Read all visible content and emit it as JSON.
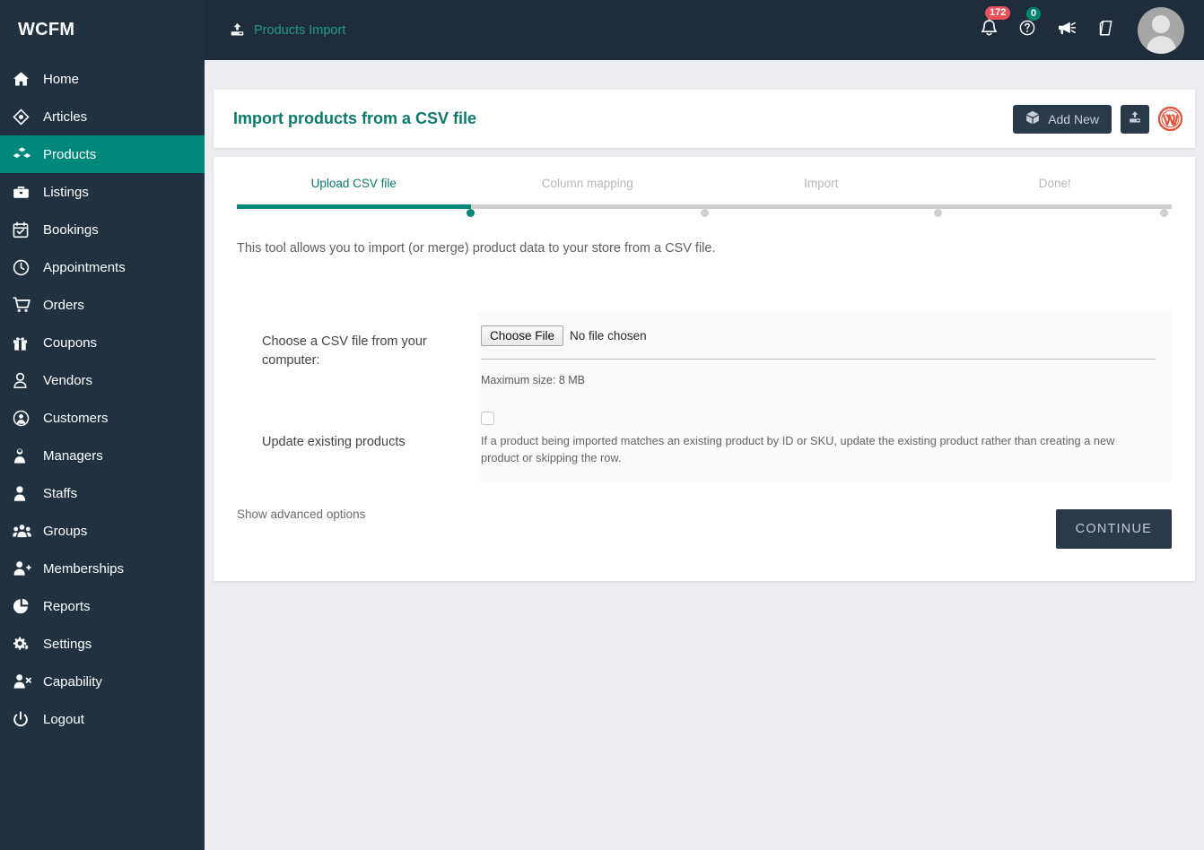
{
  "brand": {
    "name": "WCFM"
  },
  "breadcrumb": {
    "icon": "upload-icon",
    "label": "Products Import"
  },
  "topbar": {
    "notifications": {
      "icon": "bell-icon",
      "badge": "172",
      "badge_color": "#e8505b"
    },
    "help": {
      "icon": "question-circle-icon",
      "badge": "0",
      "badge_color": "#00856f"
    },
    "announcements": {
      "icon": "megaphone-icon"
    },
    "knowledgebase": {
      "icon": "book-icon"
    },
    "profile": {
      "icon": "avatar-icon"
    }
  },
  "sidebar": {
    "items": [
      {
        "icon": "home-icon",
        "label": "Home",
        "active": false
      },
      {
        "icon": "articles-icon",
        "label": "Articles",
        "active": false
      },
      {
        "icon": "products-icon",
        "label": "Products",
        "active": true
      },
      {
        "icon": "briefcase-icon",
        "label": "Listings",
        "active": false
      },
      {
        "icon": "calendar-check-icon",
        "label": "Bookings",
        "active": false
      },
      {
        "icon": "clock-icon",
        "label": "Appointments",
        "active": false
      },
      {
        "icon": "cart-icon",
        "label": "Orders",
        "active": false
      },
      {
        "icon": "gift-icon",
        "label": "Coupons",
        "active": false
      },
      {
        "icon": "user-outline-icon",
        "label": "Vendors",
        "active": false
      },
      {
        "icon": "user-circle-icon",
        "label": "Customers",
        "active": false
      },
      {
        "icon": "user-lock-icon",
        "label": "Managers",
        "active": false
      },
      {
        "icon": "user-solid-icon",
        "label": "Staffs",
        "active": false
      },
      {
        "icon": "users-group-icon",
        "label": "Groups",
        "active": false
      },
      {
        "icon": "user-plus-icon",
        "label": "Memberships",
        "active": false
      },
      {
        "icon": "pie-chart-icon",
        "label": "Reports",
        "active": false
      },
      {
        "icon": "gears-icon",
        "label": "Settings",
        "active": false
      },
      {
        "icon": "user-times-icon",
        "label": "Capability",
        "active": false
      },
      {
        "icon": "power-icon",
        "label": "Logout",
        "active": false
      }
    ]
  },
  "page": {
    "title": "Import products from a CSV file",
    "actions": {
      "add_new": {
        "icon": "cube-icon",
        "label": "Add New"
      },
      "import": {
        "icon": "download-icon"
      },
      "wordpress": {
        "icon": "wordpress-icon",
        "color": "#e8513b"
      }
    }
  },
  "stepper": {
    "steps": [
      {
        "label": "Upload CSV file",
        "active": true
      },
      {
        "label": "Column mapping",
        "active": false
      },
      {
        "label": "Import",
        "active": false
      },
      {
        "label": "Done!",
        "active": false
      }
    ],
    "progress_percent": 25,
    "active_color": "#00897B",
    "inactive_color": "#cfcfcf"
  },
  "main": {
    "intro": "This tool allows you to import (or merge) product data to your store from a CSV file.",
    "file_row": {
      "label": "Choose a CSV file from your computer:",
      "choose_button": "Choose File",
      "file_status": "No file chosen",
      "max_size": "Maximum size: 8 MB"
    },
    "update_row": {
      "label": "Update existing products",
      "checked": false,
      "description": "If a product being imported matches an existing product by ID or SKU, update the existing product rather than creating a new product or skipping the row."
    },
    "advanced_link": "Show advanced options",
    "continue_button": "CONTINUE"
  }
}
